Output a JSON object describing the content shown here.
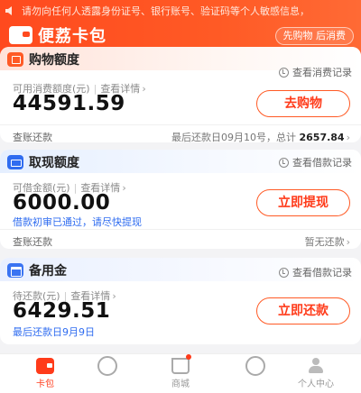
{
  "header": {
    "notice": "请勿向任何人透露身份证号、银行账号、验证码等个人敏感信息，",
    "app_name": "便荔卡包",
    "pill": "先购物 后消费"
  },
  "shopping": {
    "title": "购物额度",
    "record_link": "查看消费记录",
    "available_label": "可用消费额度(元)",
    "detail_link": "查看详情",
    "amount": "44591.59",
    "action": "去购物",
    "bill_link": "查账还款",
    "last_repay_prefix": "最后还款日09月10号，",
    "total_label": "总计",
    "total_amount": "2657.84"
  },
  "cash": {
    "title": "取现额度",
    "record_link": "查看借款记录",
    "available_label": "可借金额(元)",
    "detail_link": "查看详情",
    "amount": "6000.00",
    "action": "立即提现",
    "note": "借款初审已通过，请尽快提现",
    "bill_link": "查账还款",
    "status": "暂无还款"
  },
  "reserve": {
    "title": "备用金",
    "record_link": "查看借款记录",
    "due_label": "待还款(元)",
    "detail_link": "查看详情",
    "amount": "6429.51",
    "action": "立即还款",
    "due_date": "最后还款日9月9日"
  },
  "tabs": [
    {
      "label": "卡包"
    },
    {
      "label": "商城"
    },
    {
      "label": "个人中心"
    }
  ],
  "colors": {
    "brand": "#ff4a1e",
    "accent_blue": "#2f6cf0"
  }
}
